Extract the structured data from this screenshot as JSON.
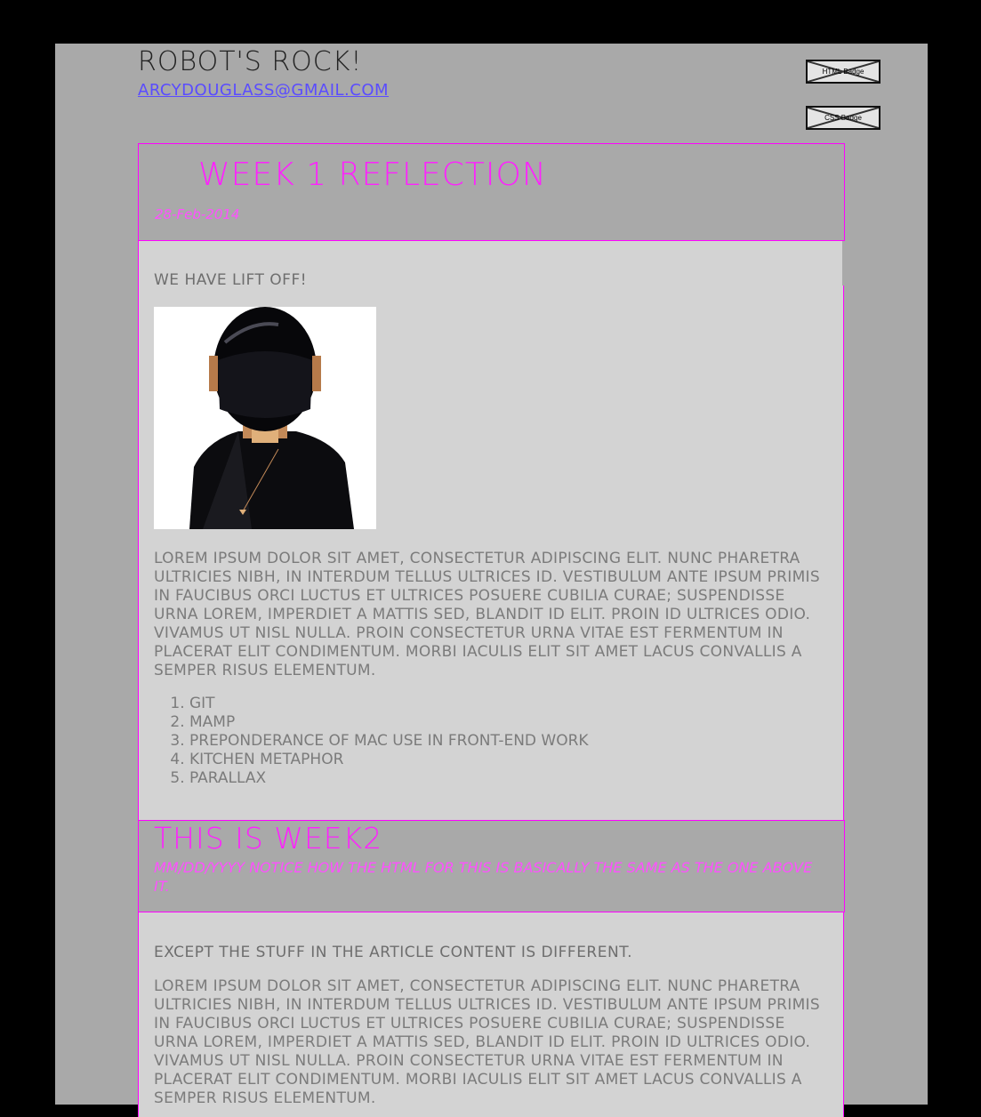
{
  "header": {
    "site_title": "Robot's Rock!",
    "email": "arcydouglass@gmail.com",
    "badges": [
      "HTML Badge",
      "CSS Badge"
    ]
  },
  "posts": [
    {
      "title": "Week 1 Reflection",
      "date": "28-Feb-2014",
      "intro": "We have lift off!",
      "image_alt": "helmeted-robot-photo",
      "paragraph": "Lorem ipsum dolor sit amet, consectetur adipiscing elit. Nunc pharetra ultricies nibh, in interdum tellus ultrices id. Vestibulum ante ipsum primis in faucibus orci luctus et ultrices posuere cubilia Curae; Suspendisse urna lorem, imperdiet a mattis sed, blandit id elit. Proin id ultrices odio. Vivamus ut nisl nulla. Proin consectetur urna vitae est fermentum in placerat elit condimentum. Morbi iaculis elit sit amet lacus convallis a semper risus elementum.",
      "list": [
        "git",
        "MAMP",
        "preponderance of Mac use in front-end work",
        "kitchen metaphor",
        "parallax"
      ]
    },
    {
      "title": "This is week2",
      "subtitle": "mm/dd/yyyy Notice how the html for this is basically the same as the one above it.",
      "intro": "Except the stuff in the article content is different.",
      "paragraph": "Lorem ipsum dolor sit amet, consectetur adipiscing elit. Nunc pharetra ultricies nibh, in interdum tellus ultrices id. Vestibulum ante ipsum primis in faucibus orci luctus et ultrices posuere cubilia Curae; Suspendisse urna lorem, imperdiet a mattis sed, blandit id elit. Proin id ultrices odio. Vivamus ut nisl nulla. Proin consectetur urna vitae est fermentum in placerat elit condimentum. Morbi iaculis elit sit amet lacus convallis a semper risus elementum."
    }
  ],
  "colors": {
    "accent": "#ff00ff",
    "page_bg": "#a9a9a9",
    "content_bg": "#d3d3d3",
    "link": "#5a4cff"
  }
}
